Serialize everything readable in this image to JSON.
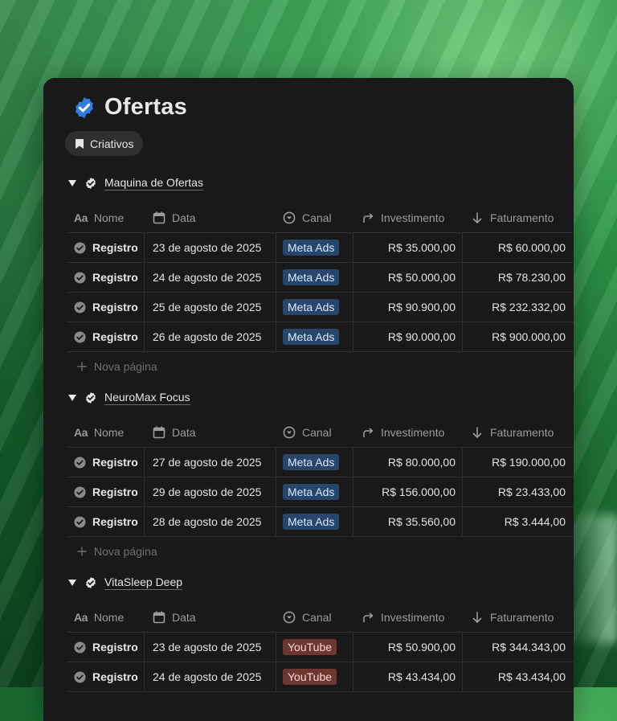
{
  "page": {
    "title": "Ofertas",
    "chip_label": "Criativos"
  },
  "columns": {
    "name": "Nome",
    "date": "Data",
    "channel": "Canal",
    "investment": "Investimento",
    "revenue": "Faturamento"
  },
  "new_page_label": "Nova página",
  "colors": {
    "meta_ads": "#28456c",
    "youtube": "#6e3630",
    "title_badge": "#2f7de1"
  },
  "groups": [
    {
      "name": "Maquina de Ofertas",
      "rows": [
        {
          "name": "Registro",
          "date": "23 de agosto de 2025",
          "channel": "Meta Ads",
          "investment": "R$ 35.000,00",
          "revenue": "R$ 60.000,00"
        },
        {
          "name": "Registro",
          "date": "24 de agosto de 2025",
          "channel": "Meta Ads",
          "investment": "R$ 50.000,00",
          "revenue": "R$ 78.230,00"
        },
        {
          "name": "Registro",
          "date": "25 de agosto de 2025",
          "channel": "Meta Ads",
          "investment": "R$ 90.900,00",
          "revenue": "R$ 232.332,00"
        },
        {
          "name": "Registro",
          "date": "26 de agosto de 2025",
          "channel": "Meta Ads",
          "investment": "R$ 90.000,00",
          "revenue": "R$ 900.000,00"
        }
      ]
    },
    {
      "name": "NeuroMax Focus",
      "rows": [
        {
          "name": "Registro",
          "date": "27 de agosto de 2025",
          "channel": "Meta Ads",
          "investment": "R$ 80.000,00",
          "revenue": "R$ 190.000,00"
        },
        {
          "name": "Registro",
          "date": "29 de agosto de 2025",
          "channel": "Meta Ads",
          "investment": "R$ 156.000,00",
          "revenue": "R$ 23.433,00"
        },
        {
          "name": "Registro",
          "date": "28 de agosto de 2025",
          "channel": "Meta Ads",
          "investment": "R$ 35.560,00",
          "revenue": "R$ 3.444,00"
        }
      ]
    },
    {
      "name": "VitaSleep Deep",
      "rows": [
        {
          "name": "Registro",
          "date": "23 de agosto de 2025",
          "channel": "YouTube",
          "investment": "R$ 50.900,00",
          "revenue": "R$ 344.343,00"
        },
        {
          "name": "Registro",
          "date": "24 de agosto de 2025",
          "channel": "YouTube",
          "investment": "R$ 43.434,00",
          "revenue": "R$ 43.434,00"
        }
      ]
    }
  ]
}
